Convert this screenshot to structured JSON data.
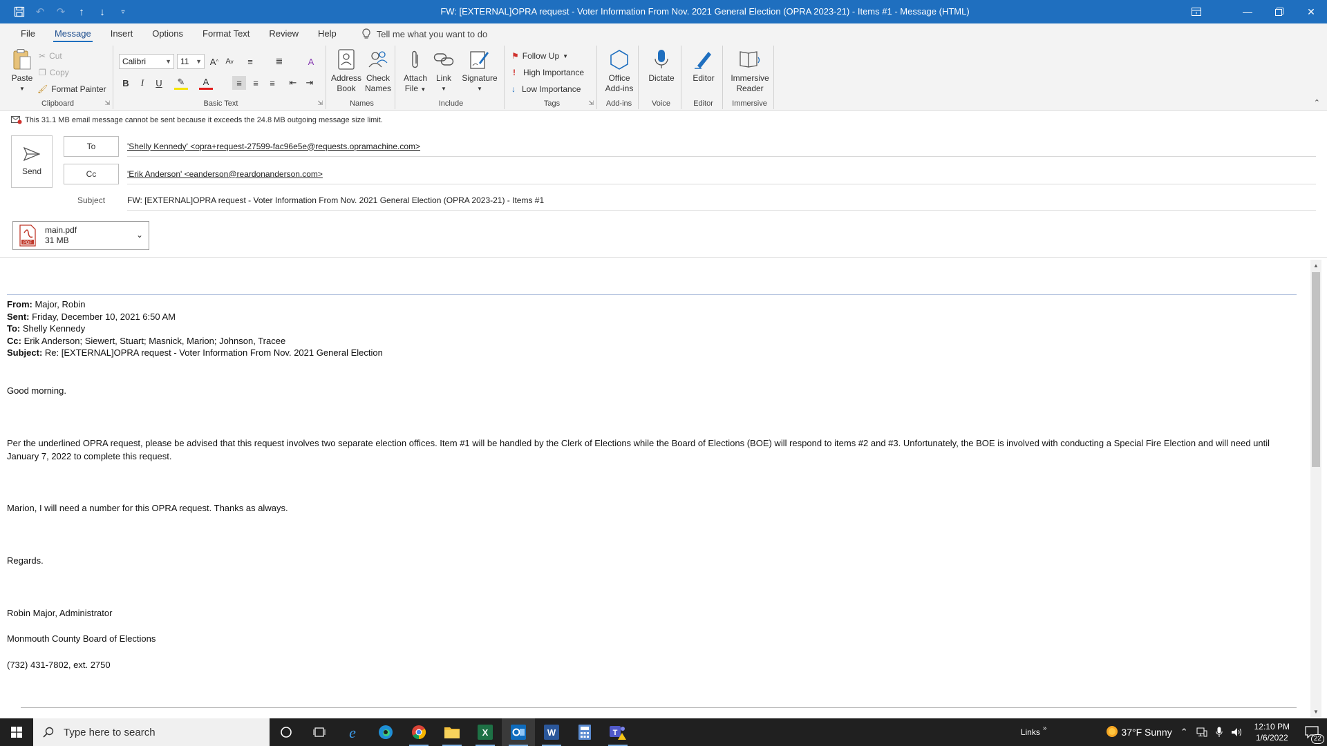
{
  "titlebar": {
    "title": "FW: [EXTERNAL]OPRA request - Voter Information From Nov. 2021 General Election (OPRA 2023-21)  - Items #1  -  Message (HTML)"
  },
  "tabs": [
    {
      "label": "File"
    },
    {
      "label": "Message"
    },
    {
      "label": "Insert"
    },
    {
      "label": "Options"
    },
    {
      "label": "Format Text"
    },
    {
      "label": "Review"
    },
    {
      "label": "Help"
    }
  ],
  "tellme": {
    "placeholder": "Tell me what you want to do"
  },
  "ribbon": {
    "clipboard": {
      "paste": "Paste",
      "cut": "Cut",
      "copy": "Copy",
      "format_painter": "Format Painter",
      "label": "Clipboard"
    },
    "basic_text": {
      "font": "Calibri",
      "size": "11",
      "label": "Basic Text"
    },
    "names": {
      "address_book_1": "Address",
      "address_book_2": "Book",
      "check_names_1": "Check",
      "check_names_2": "Names",
      "label": "Names"
    },
    "include": {
      "attach_1": "Attach",
      "attach_2": "File",
      "link": "Link",
      "signature": "Signature",
      "label": "Include"
    },
    "tags": {
      "follow_up": "Follow Up",
      "high": "High Importance",
      "low": "Low Importance",
      "label": "Tags"
    },
    "addins": {
      "office_1": "Office",
      "office_2": "Add-ins",
      "label": "Add-ins"
    },
    "voice": {
      "dictate": "Dictate",
      "label": "Voice"
    },
    "editor": {
      "editor": "Editor",
      "label": "Editor"
    },
    "immersive": {
      "reader_1": "Immersive",
      "reader_2": "Reader",
      "label": "Immersive"
    }
  },
  "compose": {
    "info": "This 31.1 MB email message cannot be sent because it exceeds the 24.8 MB outgoing message size limit.",
    "send": "Send",
    "to_label": "To",
    "to_value": "'Shelly Kennedy' <opra+request-27599-fac96e5e@requests.opramachine.com>",
    "cc_label": "Cc",
    "cc_value": "'Erik Anderson' <eanderson@reardonanderson.com>",
    "subject_label": "Subject",
    "subject_value": "FW: [EXTERNAL]OPRA request - Voter Information From Nov. 2021 General Election (OPRA 2023-21)  - Items #1",
    "attachment_name": "main.pdf",
    "attachment_size": "31 MB"
  },
  "message": {
    "from_label": "From:",
    "from": "Major, Robin",
    "sent_label": "Sent:",
    "sent": "Friday, December 10, 2021 6:50 AM",
    "to_label": "To:",
    "to": "Shelly Kennedy",
    "cc_label": "Cc:",
    "cc": "Erik Anderson; Siewert, Stuart; Masnick, Marion; Johnson, Tracee",
    "subject_label": "Subject:",
    "subject": "Re: [EXTERNAL]OPRA request - Voter Information From Nov. 2021 General Election",
    "greeting": "Good morning.",
    "para1": "Per the underlined OPRA request, please be advised that this request involves two separate election offices.  Item #1 will be handled by the Clerk of Elections while the Board of Elections (BOE) will respond to items #2 and #3.  Unfortunately, the BOE is involved with conducting a Special Fire Election and will need until January 7, 2022 to complete this request.",
    "para2": "Marion, I will need a number for this OPRA request.  Thanks as always.",
    "closing": "Regards.",
    "sig_name": "Robin Major, Administrator",
    "sig_org": "Monmouth County Board of Elections",
    "sig_phone": "(732) 431-7802, ext. 2750"
  },
  "taskbar": {
    "search_placeholder": "Type here to search",
    "links": "Links",
    "weather": "37°F  Sunny",
    "time": "12:10 PM",
    "date": "1/6/2022",
    "notifications": "22"
  }
}
